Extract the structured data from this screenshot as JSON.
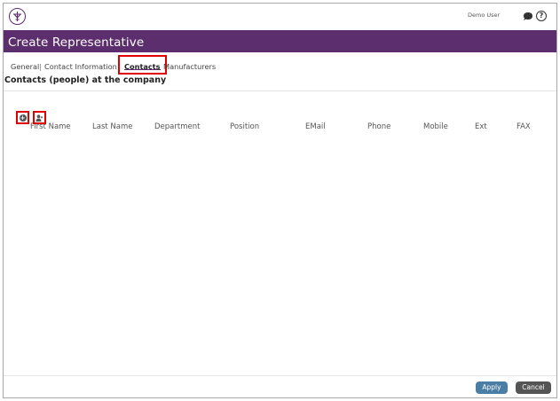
{
  "topbar": {
    "user_name": "Demo User",
    "icons": {
      "logo": "company-logo",
      "chat": "chat-icon",
      "help": "help-icon"
    },
    "help_glyph": "?"
  },
  "header": {
    "title": "Create Representative",
    "background": "#5d2e6d"
  },
  "tabs": [
    {
      "label": "General"
    },
    {
      "label": "Contact Information"
    },
    {
      "label": "Contacts",
      "active": true
    },
    {
      "label": "Manufacturers"
    }
  ],
  "tab_separator": "|",
  "section": {
    "title": "Contacts (people) at the company"
  },
  "toolbar": {
    "add_icon": "plus-circle-icon",
    "add_glyph": "+",
    "person_icon": "person-icon"
  },
  "grid": {
    "columns": [
      "First Name",
      "Last Name",
      "Department",
      "Position",
      "EMail",
      "Phone",
      "Mobile",
      "Ext",
      "FAX"
    ],
    "rows": []
  },
  "footer": {
    "apply_label": "Apply",
    "cancel_label": "Cancel",
    "apply_color": "#4a7ea5",
    "cancel_color": "#555555"
  },
  "highlight_color": "#e00000"
}
